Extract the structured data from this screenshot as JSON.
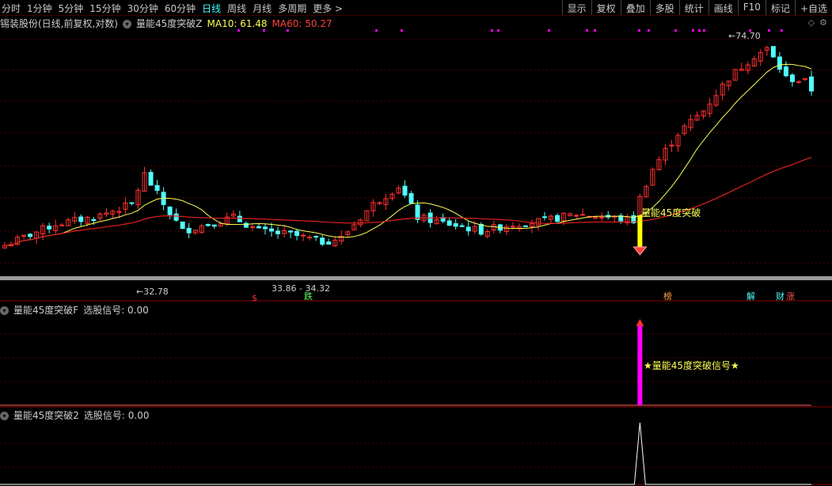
{
  "toolbar": {
    "periods": [
      "分时",
      "1分钟",
      "5分钟",
      "15分钟",
      "30分钟",
      "60分钟",
      "日线",
      "周线",
      "月线",
      "多周期",
      "更多 >"
    ],
    "active_period": "日线",
    "right_buttons": [
      "显示",
      "复权",
      "叠加",
      "多股",
      "统计",
      "画线",
      "F10",
      "标记",
      "+自选"
    ]
  },
  "main_panel": {
    "title": "锡装股份(日线,前复权,对数)",
    "indicator_name": "量能45度突破Z",
    "ma10_label": "MA10: 61.48",
    "ma60_label": "MA60: 50.27",
    "icon_diamond": "diamond-icon",
    "icon_settings": "gear-icon"
  },
  "panel2": {
    "title": "量能45度突破F",
    "value_label": "选股信号: 0.00"
  },
  "panel3": {
    "title": "量能45度突破2",
    "value_label": "选股信号: 0.00"
  },
  "colors": {
    "up": "#ff3030",
    "down": "#50ffff",
    "ma10": "#ffff55",
    "ma60": "#e02020",
    "signal": "#ff00ff",
    "grid": "#5a0000",
    "gray_band": "#9a9a9a"
  },
  "chart_data": [
    {
      "type": "candlestick",
      "title": "锡装股份(日线,前复权,对数)",
      "scale": "log",
      "ylim": [
        28,
        80
      ],
      "series": [
        {
          "name": "MA10",
          "current": 61.48
        },
        {
          "name": "MA60",
          "current": 50.27
        }
      ],
      "annotations": [
        {
          "text": "32.78",
          "kind": "low-marker"
        },
        {
          "text": "33.86 - 34.32",
          "kind": "range-marker"
        },
        {
          "text": "74.70",
          "kind": "high-marker"
        },
        {
          "text": "量能45度突破",
          "kind": "signal-label"
        },
        {
          "text": "$",
          "kind": "event"
        },
        {
          "text": "跌",
          "kind": "event"
        },
        {
          "text": "榜",
          "kind": "event"
        },
        {
          "text": "解",
          "kind": "event"
        },
        {
          "text": "财",
          "kind": "event"
        },
        {
          "text": "涨",
          "kind": "event"
        }
      ],
      "signal_index": 100,
      "n_bars": 128
    },
    {
      "type": "bar",
      "title": "量能45度突破F",
      "series": [
        {
          "name": "选股信号",
          "current": 0.0
        }
      ],
      "signal_index": 100,
      "signal_label": "★量能45度突破信号★"
    },
    {
      "type": "line",
      "title": "量能45度突破2",
      "series": [
        {
          "name": "选股信号",
          "current": 0.0
        }
      ],
      "signal_index": 100
    }
  ]
}
